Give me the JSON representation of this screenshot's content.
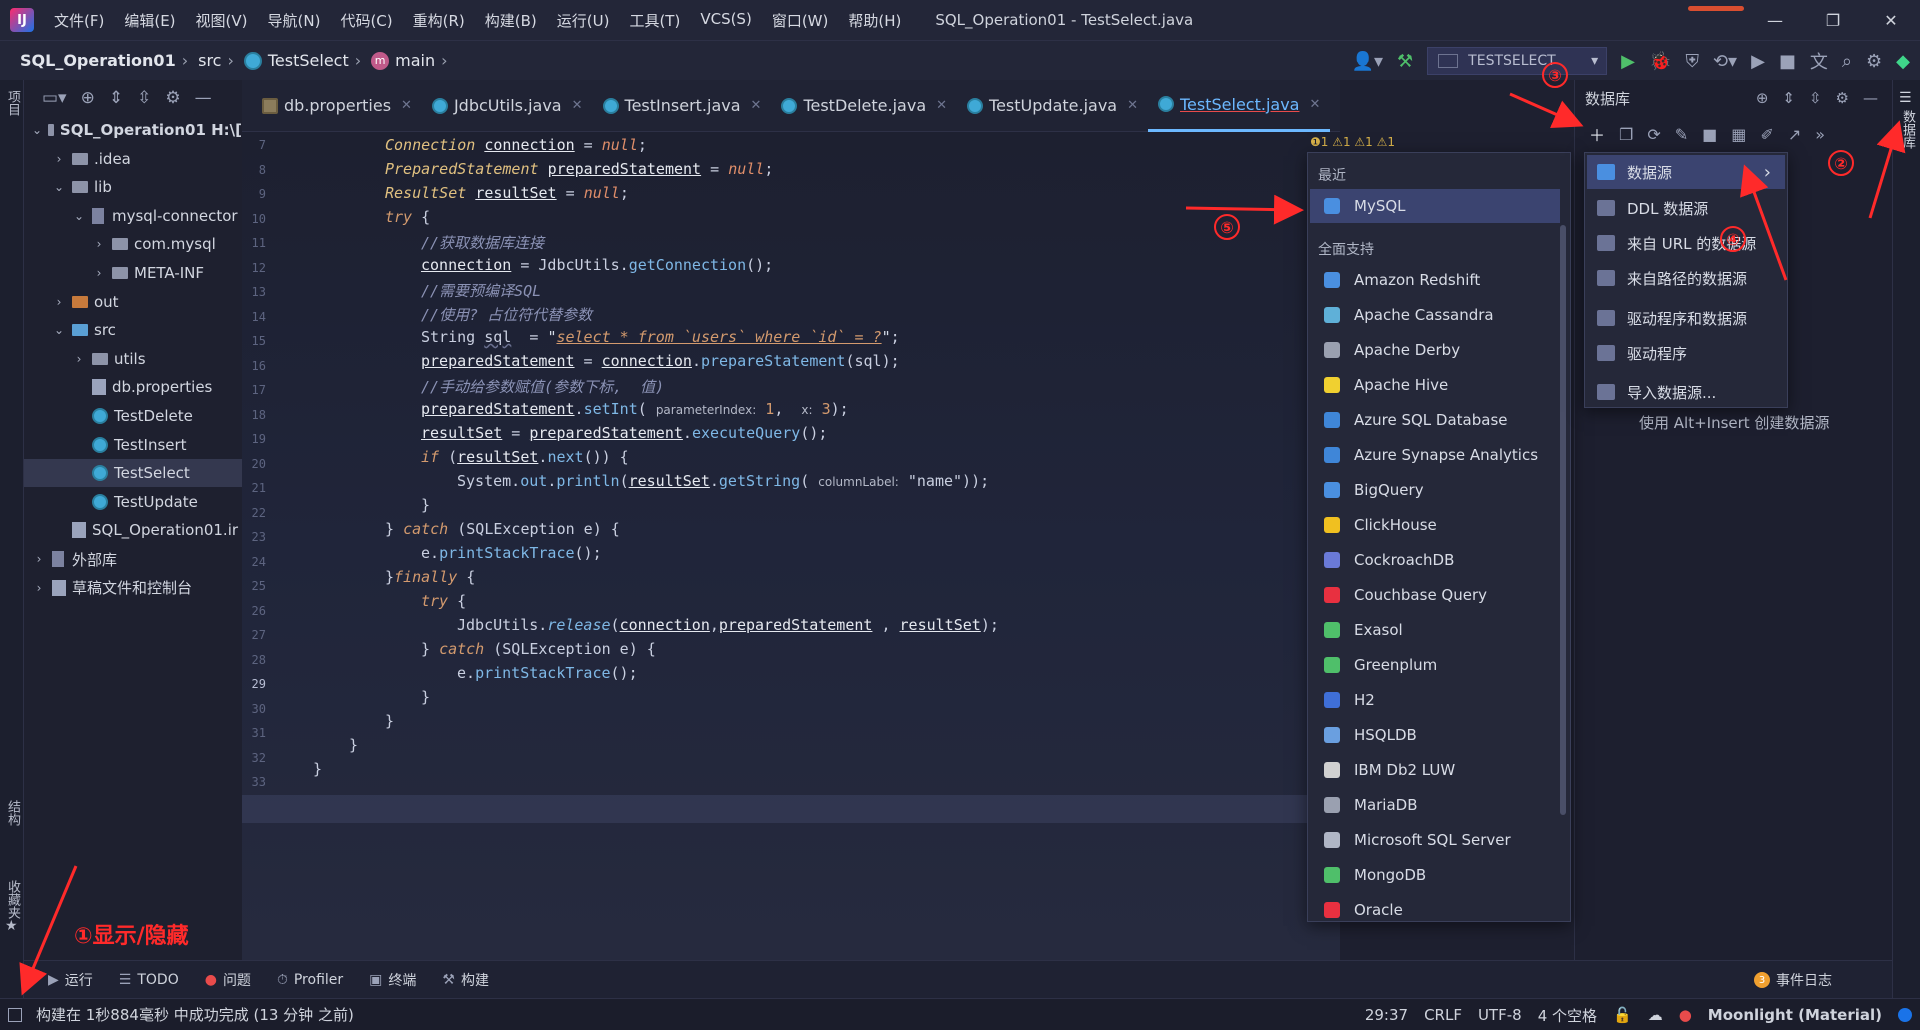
{
  "app": {
    "title": "SQL_Operation01 - TestSelect.java",
    "menu": [
      "文件(F)",
      "编辑(E)",
      "视图(V)",
      "导航(N)",
      "代码(C)",
      "重构(R)",
      "构建(B)",
      "运行(U)",
      "工具(T)",
      "VCS(S)",
      "窗口(W)",
      "帮助(H)"
    ],
    "window_controls": [
      "—",
      "❐",
      "✕"
    ]
  },
  "navbar": {
    "project": "SQL_Operation01",
    "src": "src",
    "class": "TestSelect",
    "method": "main",
    "run_config": "TESTSELECT"
  },
  "left_stripe": {
    "project_label": "项目",
    "structure_label": "结构",
    "favorites_label": "收藏夹"
  },
  "project_tree": [
    {
      "label": "SQL_Operation01  H:\\[",
      "depth": 0,
      "arrow": "⌄",
      "kind": "folder"
    },
    {
      "label": ".idea",
      "depth": 1,
      "arrow": "›",
      "kind": "folder"
    },
    {
      "label": "lib",
      "depth": 1,
      "arrow": "⌄",
      "kind": "folder"
    },
    {
      "label": "mysql-connector",
      "depth": 2,
      "arrow": "⌄",
      "kind": "jar"
    },
    {
      "label": "com.mysql",
      "depth": 3,
      "arrow": "›",
      "kind": "folder"
    },
    {
      "label": "META-INF",
      "depth": 3,
      "arrow": "›",
      "kind": "folder"
    },
    {
      "label": "out",
      "depth": 1,
      "arrow": "›",
      "kind": "folder-orange"
    },
    {
      "label": "src",
      "depth": 1,
      "arrow": "⌄",
      "kind": "folder-blue"
    },
    {
      "label": "utils",
      "depth": 2,
      "arrow": "›",
      "kind": "folder"
    },
    {
      "label": "db.properties",
      "depth": 2,
      "arrow": "",
      "kind": "file"
    },
    {
      "label": "TestDelete",
      "depth": 2,
      "arrow": "",
      "kind": "class"
    },
    {
      "label": "TestInsert",
      "depth": 2,
      "arrow": "",
      "kind": "class"
    },
    {
      "label": "TestSelect",
      "depth": 2,
      "arrow": "",
      "kind": "class",
      "selected": true
    },
    {
      "label": "TestUpdate",
      "depth": 2,
      "arrow": "",
      "kind": "class"
    },
    {
      "label": "SQL_Operation01.ir",
      "depth": 1,
      "arrow": "",
      "kind": "file"
    },
    {
      "label": "外部库",
      "depth": 0,
      "arrow": "›",
      "kind": "lib"
    },
    {
      "label": "草稿文件和控制台",
      "depth": 0,
      "arrow": "›",
      "kind": "scratch"
    }
  ],
  "tabs": [
    {
      "label": "db.properties",
      "kind": "prop"
    },
    {
      "label": "JdbcUtils.java",
      "kind": "class"
    },
    {
      "label": "TestInsert.java",
      "kind": "class"
    },
    {
      "label": "TestDelete.java",
      "kind": "class"
    },
    {
      "label": "TestUpdate.java",
      "kind": "class"
    },
    {
      "label": "TestSelect.java",
      "kind": "class",
      "active": true
    }
  ],
  "editor": {
    "warnings": "❶1  ⚠1  ⚠1  ⚠1",
    "line_numbers": [
      "7",
      "8",
      "9",
      "10",
      "11",
      "12",
      "13",
      "14",
      "15",
      "16",
      "17",
      "18",
      "19",
      "20",
      "21",
      "22",
      "23",
      "24",
      "25",
      "26",
      "27",
      "28",
      "29",
      "30",
      "31",
      "32",
      "33"
    ],
    "current_line": "29"
  },
  "popup_main": {
    "section_recent": "最近",
    "recent": [
      "MySQL"
    ],
    "section_all": "全面支持",
    "items": [
      "Amazon Redshift",
      "Apache Cassandra",
      "Apache Derby",
      "Apache Hive",
      "Azure SQL Database",
      "Azure Synapse Analytics",
      "BigQuery",
      "ClickHouse",
      "CockroachDB",
      "Couchbase Query",
      "Exasol",
      "Greenplum",
      "H2",
      "HSQLDB",
      "IBM Db2 LUW",
      "MariaDB",
      "Microsoft SQL Server",
      "MongoDB",
      "Oracle"
    ]
  },
  "popup_sub": {
    "items": [
      "数据源",
      "DDL 数据源",
      "来自 URL 的数据源",
      "来自路径的数据源",
      "驱动程序和数据源",
      "驱动程序",
      "导入数据源..."
    ]
  },
  "db_panel": {
    "title": "数据库",
    "hint": "使用 Alt+Insert 创建数据源",
    "stripe_label": "数据库"
  },
  "bottom_tools": [
    "运行",
    "TODO",
    "问题",
    "Profiler",
    "终端",
    "构建"
  ],
  "event_log": "事件日志",
  "status": {
    "message": "构建在 1秒884毫秒 中成功完成 (13 分钟 之前)",
    "position": "29:37",
    "line_sep": "CRLF",
    "encoding": "UTF-8",
    "indent": "4 个空格",
    "theme": "Moonlight (Material)"
  },
  "annotations": {
    "a1": "①显示/隐藏",
    "a2": "②",
    "a3": "③",
    "a4": "④",
    "a5": "⑤"
  }
}
